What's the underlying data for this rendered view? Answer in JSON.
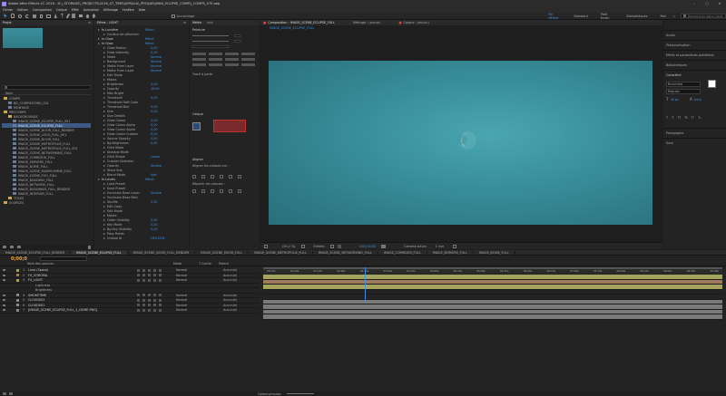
{
  "titlebar": {
    "title": "Adobe After Effects CC 2016 - D:\\_STORAGE\\_PROJECTS\\2016_07_TIME\\\\APSULA\\_PROJ\\AE\\\\MINI_ECLIPSE_COMP\\\\_COMPS_070.aep",
    "min": "–",
    "max": "▢",
    "close": "✕"
  },
  "menu": [
    "Fichier",
    "Edition",
    "Composition",
    "Calque",
    "Effet",
    "Animation",
    "Affichage",
    "Fenêtre",
    "Aide"
  ],
  "toolbar": {
    "snap_label": "Accrochage",
    "workspaces": [
      "Par défaut",
      "Standard",
      "Petit écran",
      "Bibliothèques",
      "Mot"
    ],
    "search_placeholder": "Rechercher dans l'aide"
  },
  "project": {
    "tab": "Projet",
    "search_placeholder": "",
    "header": "Nom",
    "items": [
      {
        "label": "COMPS",
        "type": "folder",
        "level": 0
      },
      {
        "label": "BG_COMPOSITING_001",
        "type": "comp",
        "level": 1
      },
      {
        "label": "MONTAGE",
        "type": "comp",
        "level": 1
      },
      {
        "label": "PRECOMPS",
        "type": "folder",
        "level": 0
      },
      {
        "label": "BACKGROUNDS",
        "type": "folder",
        "level": 1
      },
      {
        "label": "IMAGE_SCENE_ECLIPSE_FULL_001",
        "type": "comp",
        "level": 2
      },
      {
        "label": "IMAGE_SCENE_ECLIPSE_FULL",
        "type": "comp",
        "level": 2,
        "selected": true
      },
      {
        "label": "IMAGE_SCENE_DOOR_FULL_RENDER",
        "type": "comp",
        "level": 2
      },
      {
        "label": "IMAGE_SCENE_LOGO_FULL_001",
        "type": "comp",
        "level": 2
      },
      {
        "label": "IMAGE_SCENE_DOOR_FULL",
        "type": "comp",
        "level": 2
      },
      {
        "label": "IMAGE_SCENE_METROPOLIS_FULL",
        "type": "comp",
        "level": 2
      },
      {
        "label": "IMAGE_SCENE_METROPOLIS_FULL_001",
        "type": "comp",
        "level": 2
      },
      {
        "label": "IMAGE_SCENE_NETWORKING_FULL",
        "type": "comp",
        "level": 2
      },
      {
        "label": "IMAGE_CORRIDOR_FULL",
        "type": "comp",
        "level": 2
      },
      {
        "label": "IMAGE_SERVERS_FULL",
        "type": "comp",
        "level": 2
      },
      {
        "label": "IMAGE_DOME_FULL",
        "type": "comp",
        "level": 2
      },
      {
        "label": "IMAGE_SCENE_MADROOMNE_FULL",
        "type": "comp",
        "level": 2
      },
      {
        "label": "IMAGE_SCENE_FOG_FULL",
        "type": "comp",
        "level": 2
      },
      {
        "label": "IMAGE_BUILDING_FULL",
        "type": "comp",
        "level": 2
      },
      {
        "label": "IMAGE_NETWORK_FULL",
        "type": "comp",
        "level": 2
      },
      {
        "label": "IMAGE_BUILDINGS_FULL_RENDER",
        "type": "comp",
        "level": 2
      },
      {
        "label": "IMAGE_INTERIOR_FULL",
        "type": "comp",
        "level": 2
      },
      {
        "label": "TITLES",
        "type": "folder",
        "level": 1
      },
      {
        "label": "SOURCES",
        "type": "folder",
        "level": 0
      }
    ]
  },
  "effects": {
    "tab": "Effets : LIGHT",
    "rows": [
      {
        "label": "fx  Lumière",
        "value": "Réinit.",
        "kind": "group"
      },
      {
        "label": "Couleur de sélection",
        "value": "",
        "kind": "prop"
      },
      {
        "label": "fx  Glow",
        "value": "Réinit.",
        "kind": "group"
      },
      {
        "label": "fx  Glow",
        "value": "Réinit.",
        "kind": "group"
      },
      {
        "label": "Glow Radius",
        "value": "0,00",
        "kind": "prop"
      },
      {
        "label": "Glow Intensity",
        "value": "0,00",
        "kind": "prop"
      },
      {
        "label": "Mode",
        "value": "Normal",
        "kind": "prop"
      },
      {
        "label": "Background",
        "value": "Normal",
        "kind": "prop"
      },
      {
        "label": "Matte From Layer",
        "value": "Normal",
        "kind": "prop"
      },
      {
        "label": "Matte From Layer",
        "value": "Normal",
        "kind": "prop"
      },
      {
        "label": "Edit Mode",
        "value": "",
        "kind": "prop"
      },
      {
        "label": "Masks",
        "value": "",
        "kind": "prop"
      },
      {
        "label": "Brightness",
        "value": "0,00",
        "kind": "prop"
      },
      {
        "label": "Opacity",
        "value": "100%",
        "kind": "prop"
      },
      {
        "label": "Max Bright",
        "value": "",
        "kind": "prop"
      },
      {
        "label": "Threshold",
        "value": "0,00",
        "kind": "prop"
      },
      {
        "label": "Threshold Soft Color",
        "value": "",
        "kind": "prop"
      },
      {
        "label": "Threshold Blur",
        "value": "0,00",
        "kind": "prop"
      },
      {
        "label": "Size",
        "value": "0,00",
        "kind": "prop"
      },
      {
        "label": "Size Details",
        "value": "",
        "kind": "prop"
      },
      {
        "label": "Glow Colors",
        "value": "0,00",
        "kind": "prop"
      },
      {
        "label": "Glow Colors Alpha",
        "value": "0,00",
        "kind": "prop"
      },
      {
        "label": "Glow Colors Alpha",
        "value": "0,00",
        "kind": "prop"
      },
      {
        "label": "Glow Colors Custom",
        "value": "0,00",
        "kind": "prop"
      },
      {
        "label": "Source Opacity",
        "value": "0,00",
        "kind": "prop"
      },
      {
        "label": "Bg Brightness",
        "value": "0,00",
        "kind": "prop"
      },
      {
        "label": "Glint Mode",
        "value": "",
        "kind": "prop"
      },
      {
        "label": "Shadow Mode",
        "value": "",
        "kind": "prop"
      },
      {
        "label": "Glint Shape",
        "value": "Linear",
        "kind": "prop"
      },
      {
        "label": "Custom Direction",
        "value": "",
        "kind": "prop"
      },
      {
        "label": "Opacity",
        "value": "Normal",
        "kind": "prop"
      },
      {
        "label": "Show Sub",
        "value": "",
        "kind": "prop"
      },
      {
        "label": "Blend Mode",
        "value": "Add",
        "kind": "prop"
      },
      {
        "label": "fx  Levels",
        "value": "Réinit.",
        "kind": "group"
      },
      {
        "label": "Load Preset",
        "value": "",
        "kind": "prop"
      },
      {
        "label": "Save Preset",
        "value": "",
        "kind": "prop"
      },
      {
        "label": "Exclusion Base Layer",
        "value": "Normal",
        "kind": "prop"
      },
      {
        "label": "Exclusion Base Path",
        "value": "",
        "kind": "prop"
      },
      {
        "label": "Shuffle",
        "value": "0,00",
        "kind": "prop"
      },
      {
        "label": "Edit Copy",
        "value": "",
        "kind": "prop"
      },
      {
        "label": "Edit Mode",
        "value": "",
        "kind": "prop"
      },
      {
        "label": "Masks",
        "value": "",
        "kind": "prop"
      },
      {
        "label": "Order Visibility",
        "value": "0,00",
        "kind": "prop"
      },
      {
        "label": "Key Mode",
        "value": "0,00",
        "kind": "prop"
      },
      {
        "label": "Bg Key Visibility",
        "value": "0,00",
        "kind": "prop"
      },
      {
        "label": "Pass Points",
        "value": "",
        "kind": "prop"
      },
      {
        "label": "Unique Id",
        "value": "HEX1234",
        "kind": "prop"
      }
    ]
  },
  "midpanel": {
    "tabs": [
      "Média",
      "Info"
    ],
    "paint_tab": "Peinture",
    "path_label": "Tracé à partir",
    "paragraph_tab": "Calque",
    "align_tab": "Aligner",
    "align_label": "Aligner les calques sur :",
    "distribute_label": "Répartir les calques :"
  },
  "viewer": {
    "tab": "Composition : IMAGE_SCENE_ECLIPSE_FULL",
    "tab2": "Métrage : (aucun)",
    "tab3": "Calque : (aucun)",
    "breadcrumb": "IMAGE_SCENE_ECLIPSE_FULL",
    "zoom": "(50,2 %)",
    "res": "Entière",
    "time": "0;00;00;00",
    "camera": "Caméra active",
    "views": "1 vue"
  },
  "right_panel": {
    "items": [
      "Audio",
      "Prévisualisation",
      "Effets et paramètres prédéfinis",
      "Bibliothèques"
    ],
    "char_tab": "Caractère",
    "font": "Bronchea",
    "style": "Regular",
    "size1": "36 px",
    "size2": "Auto",
    "para_tab": "Paragraphe",
    "tracker_tab": "Suivi"
  },
  "timeline": {
    "tabs": [
      "IMAGE_SCENE_ECLIPSE_FULL_RENDER",
      "IMAGE_SCENE_ECLIPSE_FULL",
      "IMAGE_SCENE_DOOR_FULL_RENDER",
      "IMAGE_SCENE_DOOR_FULL",
      "IMAGE_SCENE_METROPOLIS_FULL",
      "IMAGE_SCENE_NETWORKING_FULL",
      "IMAGE_CORRIDOR_FULL",
      "IMAGE_SERVERS_FULL",
      "IMAGE_DOME_FULL"
    ],
    "timecode": "0;00;0",
    "headers": {
      "name": "Nom des sources",
      "mode": "Mode",
      "track": "T  Cache",
      "parent": "Parent"
    },
    "layers": [
      {
        "num": "1",
        "name": "Lune (Space)",
        "mode": "Normal",
        "parent": "Aucun(e)",
        "color": "#a4a45c"
      },
      {
        "num": "2",
        "name": "FX_CHROMA",
        "mode": "Normal",
        "parent": "Aucun(e)",
        "color": "#a07a5a"
      },
      {
        "num": "3",
        "name": "FX_LIGHT",
        "mode": "Normal",
        "parent": "Aucun(e)",
        "color": "#a4a45c"
      },
      {
        "num": "",
        "name": "Lightness",
        "mode": "",
        "parent": "",
        "color": "",
        "sub": true
      },
      {
        "num": "",
        "name": "Brightness",
        "mode": "",
        "parent": "",
        "color": "",
        "sub": true
      },
      {
        "num": "4",
        "name": "SMOKETIME",
        "mode": "Normal",
        "parent": "Aucun(e)",
        "color": "#8a8a8a"
      },
      {
        "num": "5",
        "name": "CLOUDS02",
        "mode": "Normal",
        "parent": "Aucun(e)",
        "color": "#8a8a8a"
      },
      {
        "num": "6",
        "name": "CLOUDS01",
        "mode": "Normal",
        "parent": "Aucun(e)",
        "color": "#8a8a8a"
      },
      {
        "num": "7",
        "name": "[IMAGE_SCENE_ECLIPSE_FULL_1_DOME.PNG]",
        "mode": "Normal",
        "parent": "Aucun(e)",
        "color": "#8a8a8a"
      }
    ],
    "ruler": [
      "00:15s",
      "01:00s",
      "01:15s",
      "02:00s",
      "02:15s",
      "03:00s",
      "03:15s",
      "04:00s",
      "04:15s",
      "05:00s",
      "05:15s",
      "06:00s",
      "06:15s",
      "07:00s",
      "07:15s",
      "08:00s",
      "08:15s",
      "09:00s",
      "09:15s",
      "10:00s"
    ],
    "footer": "Options/modes"
  },
  "colors": {
    "accent": "#3d8fe0",
    "sky": "#3a8f9c",
    "layer_yellow": "#a4a45c",
    "layer_gray": "#7a7a7a"
  }
}
